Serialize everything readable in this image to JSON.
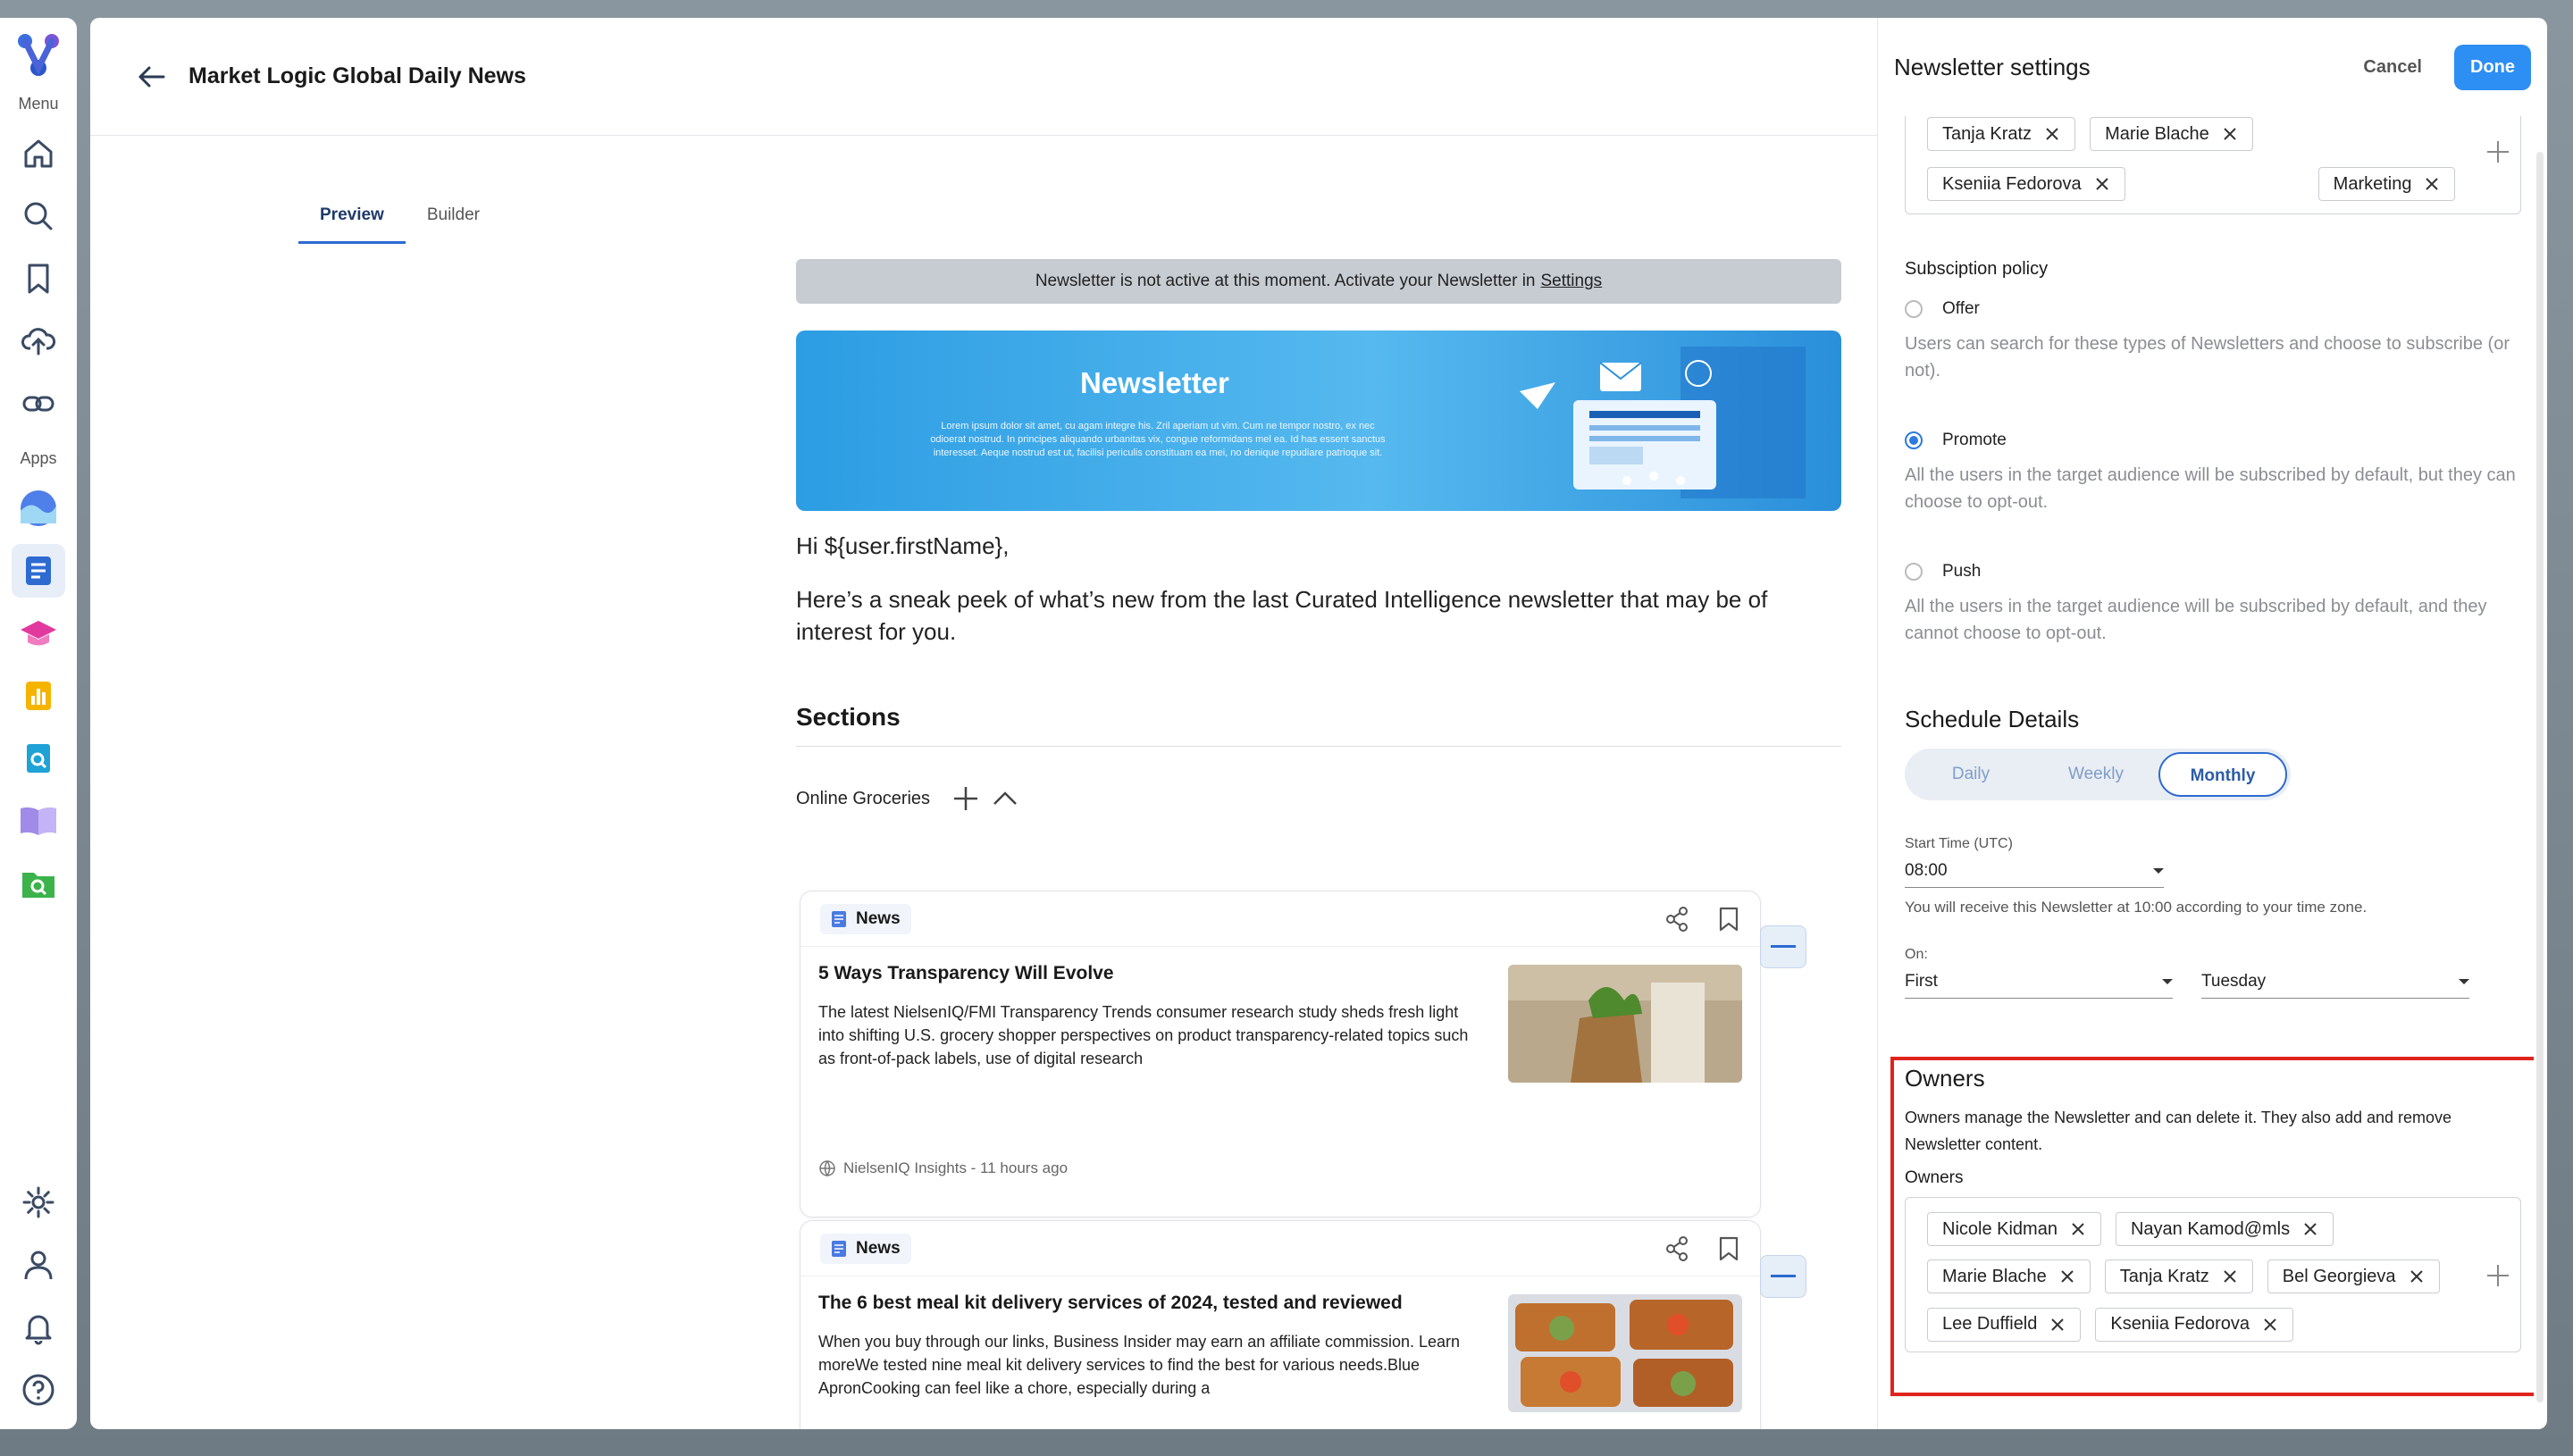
{
  "rail": {
    "menu_label": "Menu",
    "apps_label": "Apps"
  },
  "header": {
    "title": "Market Logic Global Daily News"
  },
  "tabs": [
    {
      "label": "Preview",
      "active": true
    },
    {
      "label": "Builder",
      "active": false
    }
  ],
  "preview": {
    "inactive_notice": "Newsletter is not active at this moment. Activate your Newsletter in",
    "inactive_link": "Settings",
    "hero_title": "Newsletter",
    "hero_body": "Lorem ipsum dolor sit amet, cu agam integre his. Zril aperiam ut vim. Cum ne tempor nostro, ex nec odioerat nostrud. In principes aliquando urbanitas vix, congue reformidans mel ea. Id has essent sanctus interesset. Aeque nostrud est ut, facilisi periculis constituam ea mei, no denique repudiare patrioque sit.",
    "greeting": "Hi ${user.firstName},",
    "intro": "Here’s a sneak peek of what’s new from the last Curated Intelligence newsletter that may be of interest for you.",
    "sections_title": "Sections",
    "section_name": "Online Groceries",
    "cards": [
      {
        "type_label": "News",
        "title": "5 Ways Transparency Will Evolve",
        "text": "The latest NielsenIQ/FMI Transparency Trends consumer research study sheds fresh light into shifting U.S. grocery shopper perspectives on product transparency-related topics such as front-of-pack labels, use of digital research",
        "source": "NielsenIQ Insights - 11 hours ago"
      },
      {
        "type_label": "News",
        "title": "The 6 best meal kit delivery services of 2024, tested and reviewed",
        "text": "When you buy through our links, Business Insider may earn an affiliate commission. Learn moreWe tested nine meal kit delivery services to find the best for various needs.Blue ApronCooking can feel like a chore, especially during a"
      }
    ]
  },
  "panel": {
    "title": "Newsletter settings",
    "cancel_label": "Cancel",
    "done_label": "Done",
    "audience_chips": [
      "Tanja Kratz",
      "Marie Blache",
      "Kseniia Fedorova",
      "Marketing"
    ],
    "subscription": {
      "label": "Subsciption policy",
      "options": [
        {
          "label": "Offer",
          "selected": false,
          "help": "Users can search for these types of Newsletters and choose to subscribe (or not)."
        },
        {
          "label": "Promote",
          "selected": true,
          "help": "All the users in the target audience will be subscribed by default, but they can choose to opt-out."
        },
        {
          "label": "Push",
          "selected": false,
          "help": "All the users in the target audience will be subscribed by default, and they cannot choose to opt-out."
        }
      ]
    },
    "schedule": {
      "title": "Schedule Details",
      "frequencies": [
        {
          "label": "Daily",
          "selected": false
        },
        {
          "label": "Weekly",
          "selected": false
        },
        {
          "label": "Monthly",
          "selected": true
        }
      ],
      "start_time_label": "Start Time (UTC)",
      "start_time_value": "08:00",
      "timezone_note": "You will receive this Newsletter at 10:00 according to your time zone.",
      "on_label": "On:",
      "on_week_value": "First",
      "on_day_value": "Tuesday"
    },
    "owners": {
      "heading": "Owners",
      "description": "Owners manage the Newsletter and can delete it. They also add and remove Newsletter content.",
      "field_label": "Owners",
      "chips": [
        "Nicole Kidman",
        "Nayan Kamod@mls",
        "Marie Blache",
        "Tanja Kratz",
        "Bel Georgieva",
        "Lee Duffield",
        "Kseniia Fedorova"
      ]
    }
  },
  "colors": {
    "accent": "#2d8ef3",
    "highlight_frame": "#e0241d",
    "tab_active": "#2d6bd1"
  }
}
